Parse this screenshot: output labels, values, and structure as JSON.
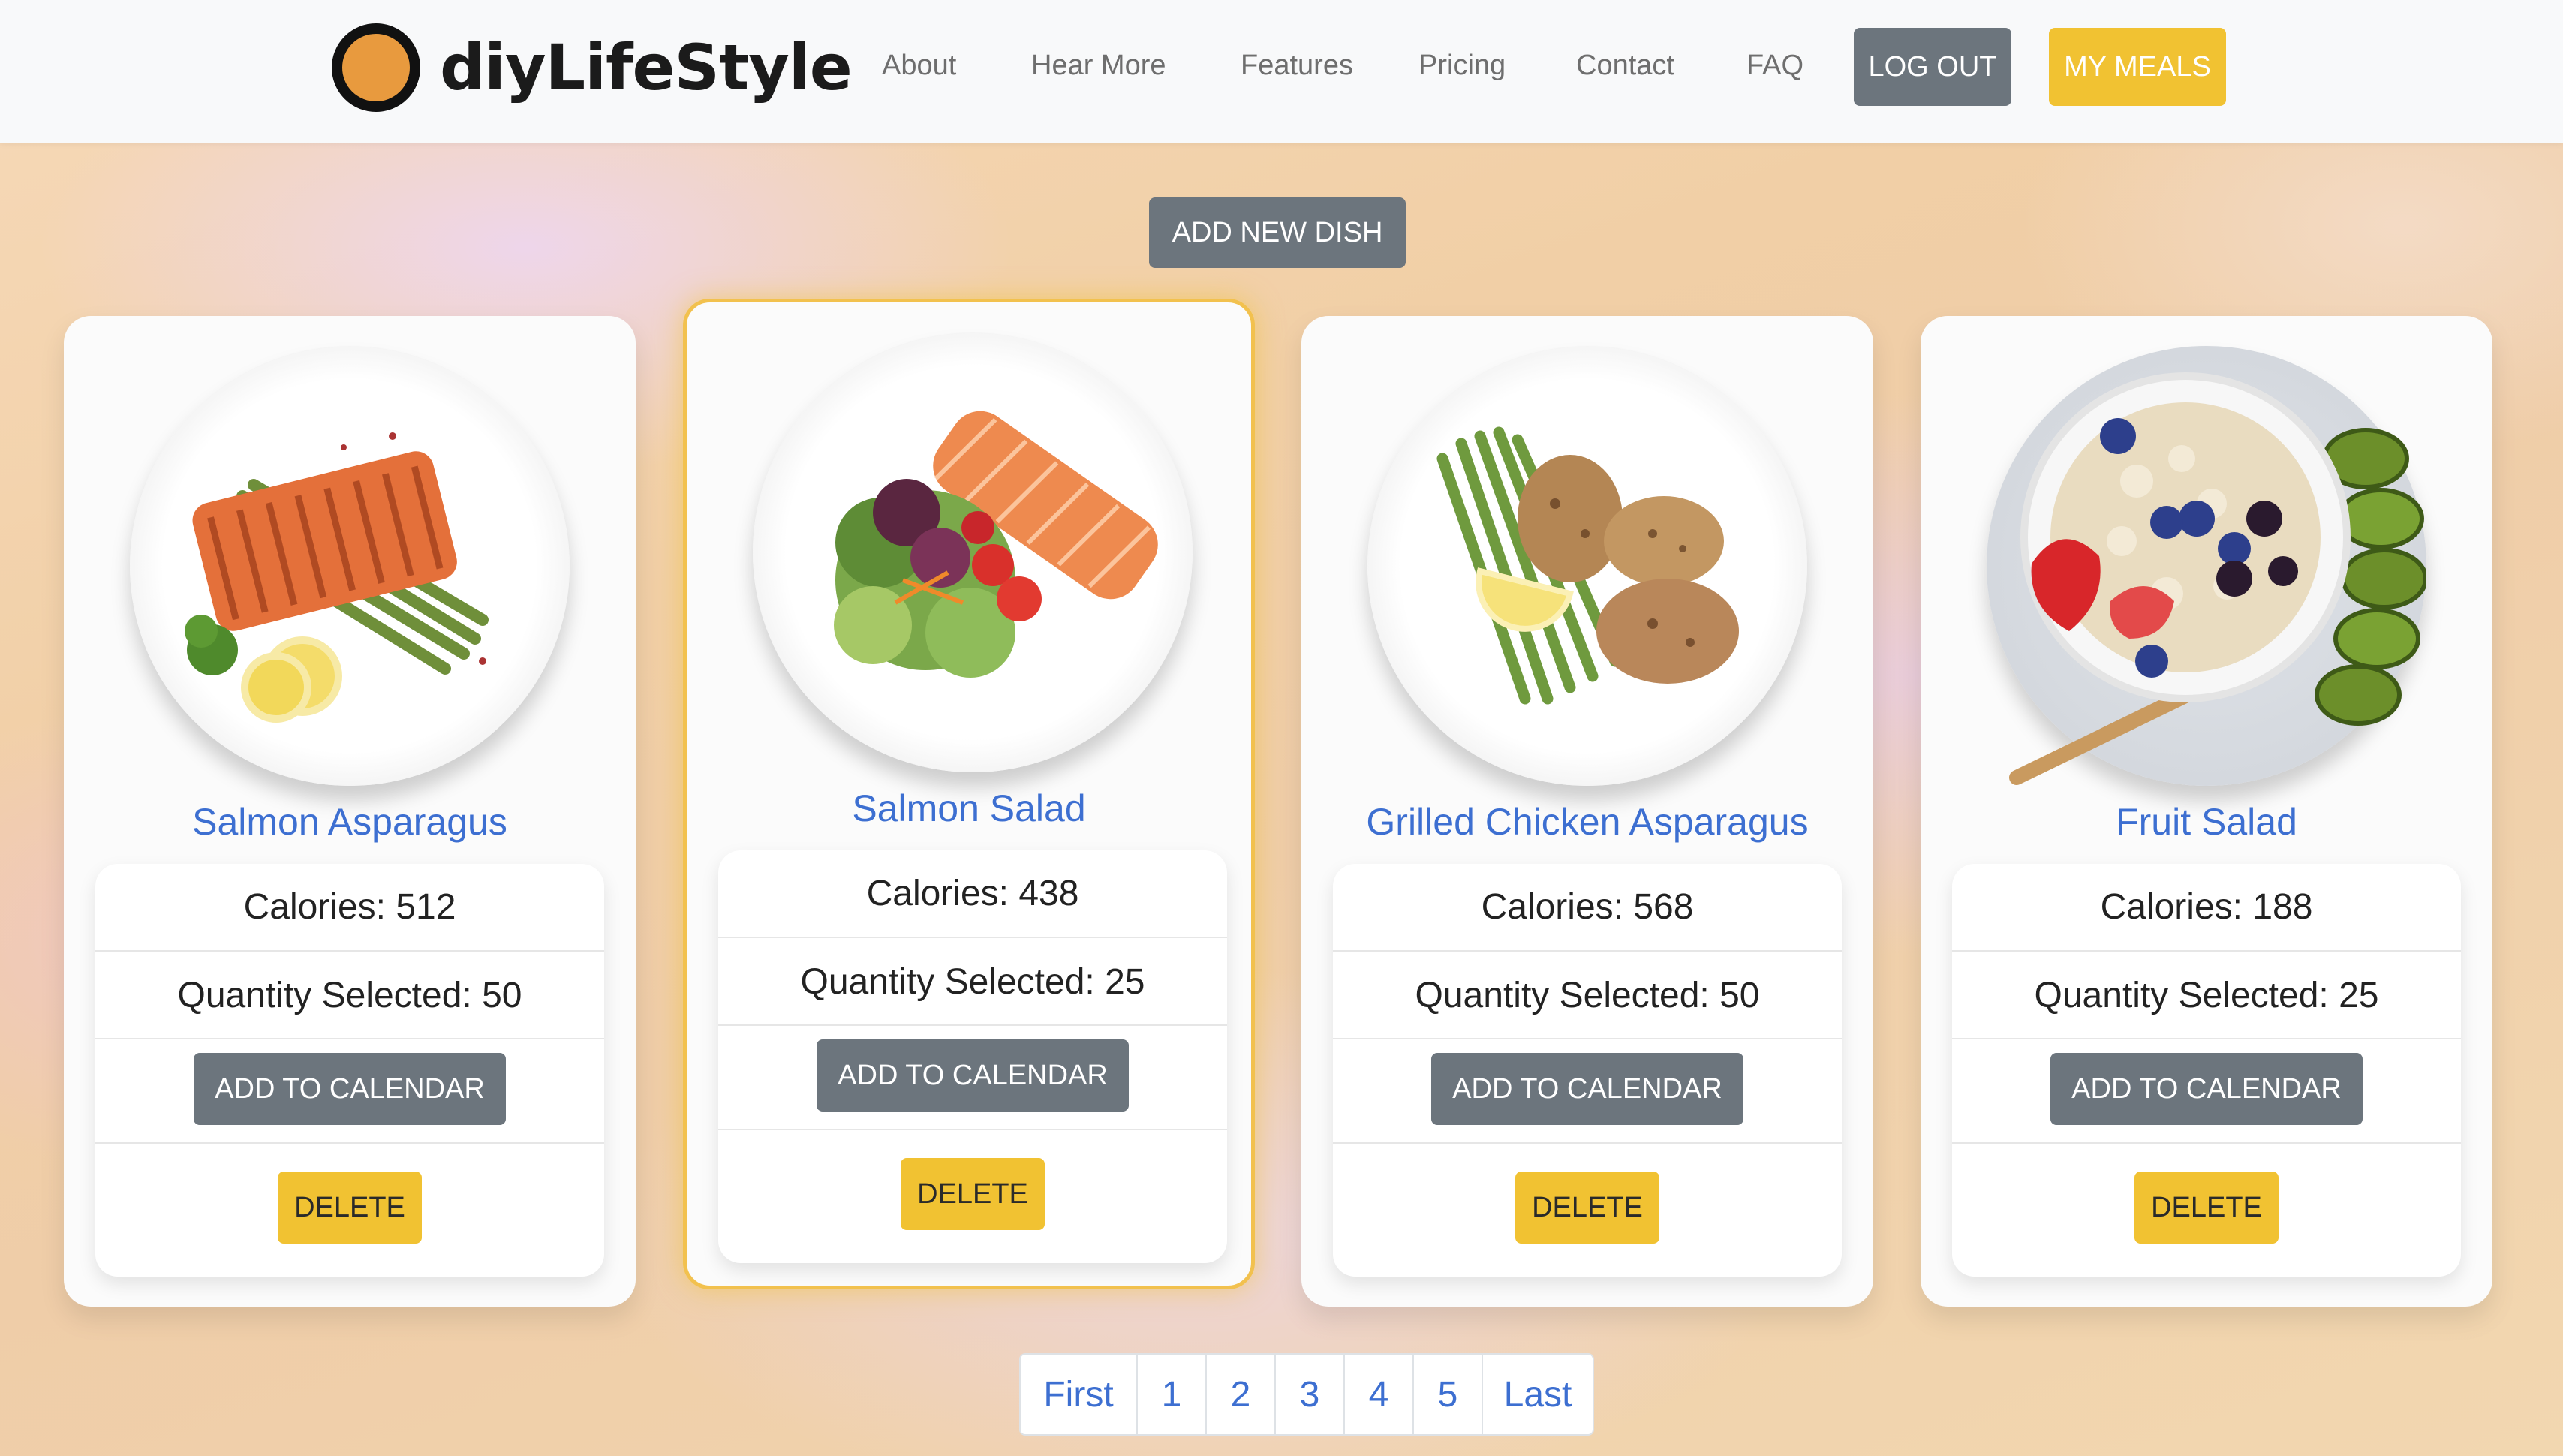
{
  "nav": {
    "brand": "diyLifeStyle",
    "links": [
      "About",
      "Hear More",
      "Features",
      "Pricing",
      "Contact",
      "FAQ"
    ],
    "logout": "LOG OUT",
    "my_meals": "MY MEALS"
  },
  "add_dish": "ADD NEW DISH",
  "dishes": [
    {
      "name": "Salmon Asparagus",
      "calories": "Calories: 512",
      "quantity": "Quantity Selected: 50",
      "add_calendar": "ADD TO CALENDAR",
      "delete": "DELETE"
    },
    {
      "name": "Salmon Salad",
      "calories": "Calories: 438",
      "quantity": "Quantity Selected: 25",
      "add_calendar": "ADD TO CALENDAR",
      "delete": "DELETE"
    },
    {
      "name": "Grilled Chicken Asparagus",
      "calories": "Calories: 568",
      "quantity": "Quantity Selected: 50",
      "add_calendar": "ADD TO CALENDAR",
      "delete": "DELETE"
    },
    {
      "name": "Fruit Salad",
      "calories": "Calories: 188",
      "quantity": "Quantity Selected: 25",
      "add_calendar": "ADD TO CALENDAR",
      "delete": "DELETE"
    }
  ],
  "pagination": [
    "First",
    "1",
    "2",
    "3",
    "4",
    "5",
    "Last"
  ],
  "colors": {
    "accent_yellow": "#f1c232",
    "button_gray": "#6c757d",
    "link_blue": "#3d6fd1"
  }
}
